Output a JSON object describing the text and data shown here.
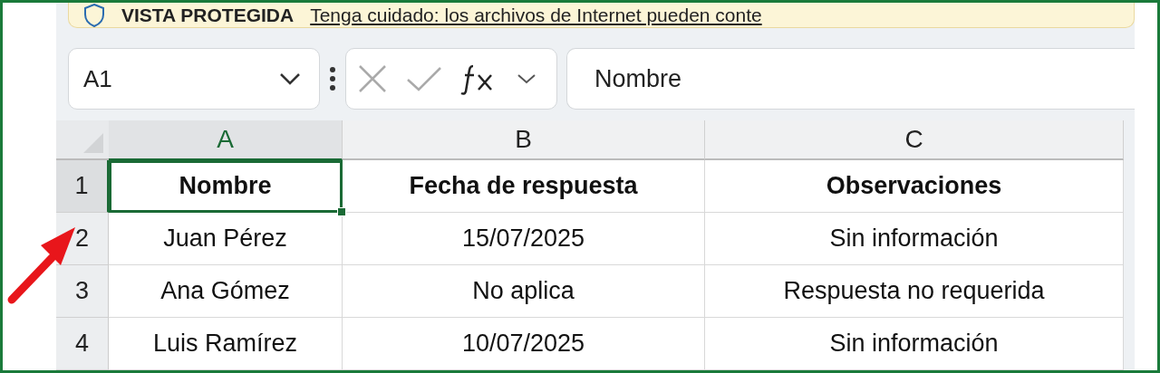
{
  "banner": {
    "title": "VISTA PROTEGIDA",
    "message": "Tenga cuidado: los archivos de Internet pueden conte"
  },
  "name_box": {
    "value": "A1"
  },
  "formula_bar": {
    "value": "Nombre"
  },
  "columns": [
    {
      "label": "A",
      "selected": true
    },
    {
      "label": "B",
      "selected": false
    },
    {
      "label": "C",
      "selected": false
    }
  ],
  "rows": [
    {
      "number": "1",
      "selected": true,
      "kind": "header",
      "cells": [
        {
          "text": "Nombre",
          "selected": true
        },
        {
          "text": "Fecha de respuesta",
          "selected": false
        },
        {
          "text": "Observaciones",
          "selected": false
        }
      ]
    },
    {
      "number": "2",
      "selected": false,
      "kind": "data",
      "cells": [
        {
          "text": "Juan Pérez",
          "selected": false
        },
        {
          "text": "15/07/2025",
          "selected": false
        },
        {
          "text": "Sin información",
          "selected": false
        }
      ]
    },
    {
      "number": "3",
      "selected": false,
      "kind": "data",
      "cells": [
        {
          "text": "Ana Gómez",
          "selected": false
        },
        {
          "text": "No aplica",
          "selected": false
        },
        {
          "text": "Respuesta no requerida",
          "selected": false
        }
      ]
    },
    {
      "number": "4",
      "selected": false,
      "kind": "data",
      "cells": [
        {
          "text": "Luis Ramírez",
          "selected": false
        },
        {
          "text": "10/07/2025",
          "selected": false
        },
        {
          "text": "Sin información",
          "selected": false
        }
      ]
    }
  ]
}
